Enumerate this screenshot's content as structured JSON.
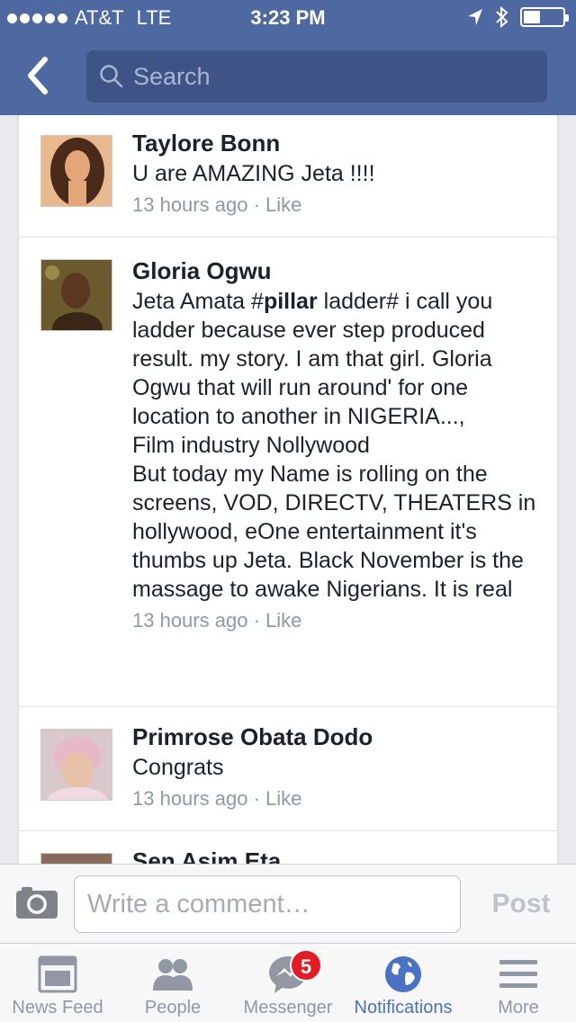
{
  "status_bar": {
    "carrier": "AT&T",
    "network": "LTE",
    "time": "3:23 PM",
    "signal_dots": 5,
    "battery_level": 0.35
  },
  "nav": {
    "search_placeholder": "Search"
  },
  "comments": [
    {
      "author": "Taylore Bonn",
      "text": "U are AMAZING Jeta !!!!",
      "time": "13 hours ago",
      "separator": "·",
      "like_label": "Like"
    },
    {
      "author": "Gloria Ogwu",
      "text_before_bold": "Jeta Amata #",
      "text_bold": "pillar",
      "text_after_bold": " ladder# i call you ladder because ever step produced result. my story. I am that girl. Gloria Ogwu that will run around' for one location to another in NIGERIA...,\nFilm industry Nollywood\nBut today my Name is rolling on the screens, VOD, DIRECTV, THEATERS in hollywood, eOne entertainment it's thumbs up Jeta. Black November is the massage to awake Nigerians. It is real",
      "time": "13 hours ago",
      "separator": "·",
      "like_label": "Like"
    },
    {
      "author": "Primrose Obata Dodo",
      "text": "Congrats",
      "time": "13 hours ago",
      "separator": "·",
      "like_label": "Like"
    },
    {
      "author": "Sen Asim Eta"
    }
  ],
  "composer": {
    "placeholder": "Write a comment…",
    "post_label": "Post"
  },
  "tabs": [
    {
      "label": "News Feed",
      "icon": "news-feed-icon"
    },
    {
      "label": "People",
      "icon": "people-icon"
    },
    {
      "label": "Messenger",
      "icon": "messenger-icon",
      "badge": "5"
    },
    {
      "label": "Notifications",
      "icon": "globe-icon",
      "active": true
    },
    {
      "label": "More",
      "icon": "menu-icon"
    }
  ],
  "colors": {
    "brand_blue": "#4e69a2",
    "search_bg": "#3e5487",
    "active_tab": "#4a72c4",
    "badge_red": "#e41b23"
  }
}
